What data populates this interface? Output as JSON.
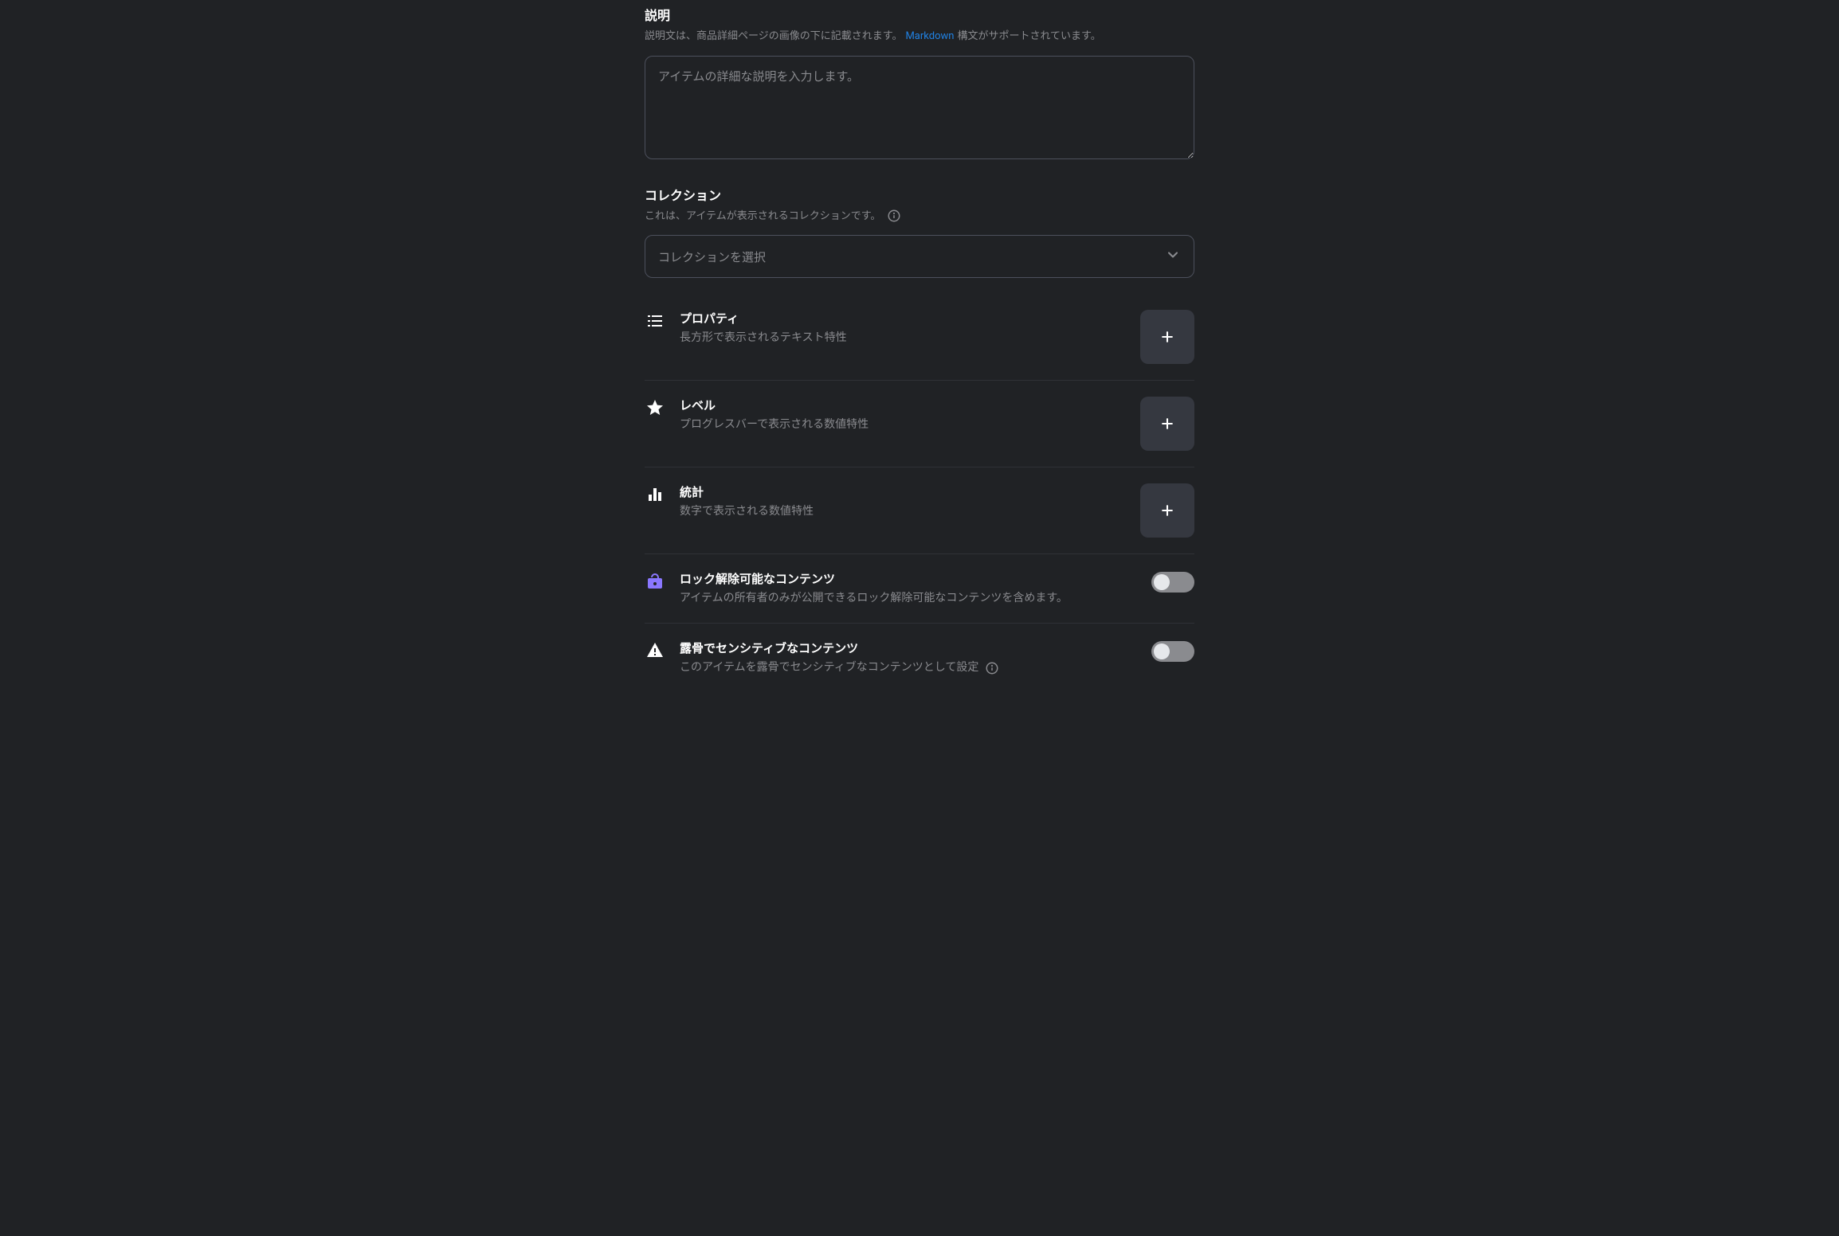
{
  "description": {
    "title": "説明",
    "hint_before": "説明文は、商品詳細ページの画像の下に記載されます。",
    "markdown_link": "Markdown",
    "hint_after": " 構文がサポートされています。",
    "placeholder": "アイテムの詳細な説明を入力します。"
  },
  "collection": {
    "title": "コレクション",
    "hint": "これは、アイテムが表示されるコレクションです。",
    "placeholder": "コレクションを選択"
  },
  "traits": [
    {
      "id": "properties",
      "icon": "list-icon",
      "title": "プロパティ",
      "desc": "長方形で表示されるテキスト特性",
      "action": "add"
    },
    {
      "id": "levels",
      "icon": "star-icon",
      "title": "レベル",
      "desc": "プログレスバーで表示される数値特性",
      "action": "add"
    },
    {
      "id": "stats",
      "icon": "bars-icon",
      "title": "統計",
      "desc": "数字で表示される数値特性",
      "action": "add"
    },
    {
      "id": "unlockable",
      "icon": "lock-icon",
      "title": "ロック解除可能なコンテンツ",
      "desc": "アイテムの所有者のみが公開できるロック解除可能なコンテンツを含めます。",
      "action": "toggle"
    },
    {
      "id": "explicit",
      "icon": "warning-icon",
      "title": "露骨でセンシティブなコンテンツ",
      "desc": "このアイテムを露骨でセンシティブなコンテンツとして設定",
      "has_info": true,
      "action": "toggle"
    }
  ]
}
